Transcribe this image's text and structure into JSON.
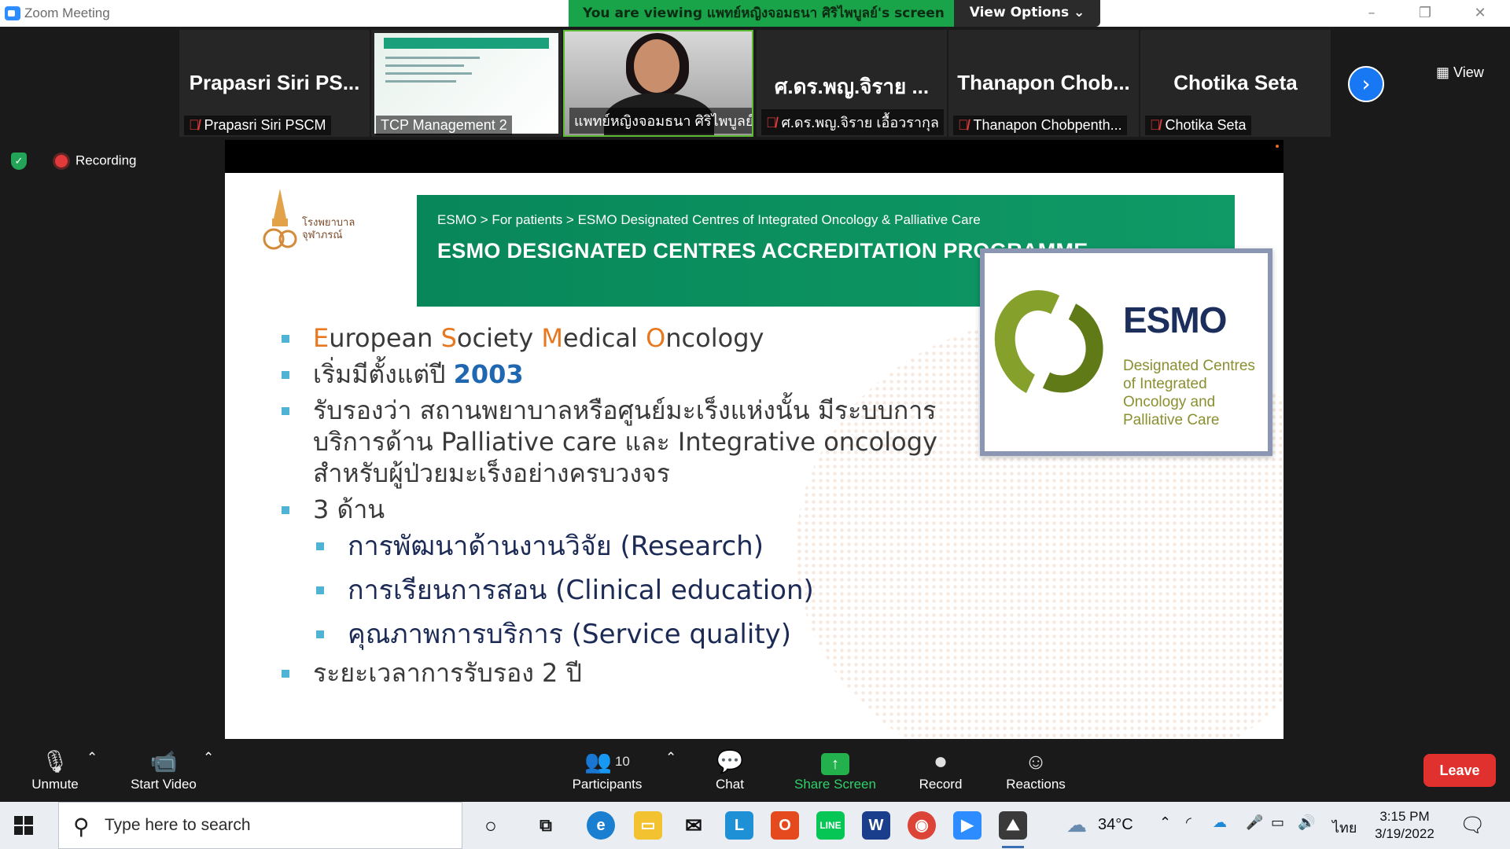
{
  "window": {
    "title": "Zoom Meeting"
  },
  "banner": {
    "text": "You are viewing แพทย์หญิงจอมธนา ศิริไพบูลย์'s screen",
    "view_options": "View Options ⌄"
  },
  "strip": {
    "tiles": [
      {
        "big": "Prapasri  Siri  PS...",
        "label": "Prapasri Siri PSCM",
        "muted": true
      },
      {
        "big": "",
        "label": "TCP Management 2",
        "muted": false
      },
      {
        "big": "",
        "label": "แพทย์หญิงจอมธนา ศิริไพบูลย์",
        "muted": false
      },
      {
        "big": "ศ.ดร.พญ.จิราย ...",
        "label": "ศ.ดร.พญ.จิราย เอื้อวรากุล ...",
        "muted": true
      },
      {
        "big": "Thanapon  Chob...",
        "label": "Thanapon Chobpenth...",
        "muted": true
      },
      {
        "big": "Chotika Seta",
        "label": "Chotika Seta",
        "muted": true
      }
    ],
    "view_label": "View"
  },
  "recording": {
    "label": "Recording"
  },
  "slide": {
    "hospital": {
      "line1": "โรงพยาบาล",
      "line2": "จุฬาภรณ์"
    },
    "header": {
      "breadcrumb": "ESMO  >  For patients  >  ESMO Designated Centres of Integrated Oncology & Palliative Care",
      "title": "ESMO DESIGNATED CENTRES ACCREDITATION PROGRAMME"
    },
    "esmo_logo": {
      "word": "ESMO",
      "subtitle": "Designated Centres of Integrated Oncology and Palliative Care"
    },
    "bullets": {
      "b1": {
        "e": "E",
        "uropean": "uropean ",
        "s": "S",
        "ociety": "ociety ",
        "m": "M",
        "edical": "edical ",
        "o": "O",
        "ncology": "ncology"
      },
      "b2": {
        "text": "เริ่มมีตั้งแต่ปี ",
        "year": "2003"
      },
      "b3": "รับรองว่า สถานพยาบาลหรือศูนย์มะเร็งแห่งนั้น มีระบบการบริการด้าน Palliative care และ Integrative oncology สำหรับผู้ป่วยมะเร็งอย่างครบวงจร",
      "b4": "3 ด้าน",
      "sub1": "การพัฒนาด้านงานวิจัย (Research)",
      "sub2": "การเรียนการสอน (Clinical education)",
      "sub3": "คุณภาพการบริการ (Service quality)",
      "b5": "ระยะเวลาการรับรอง 2 ปี"
    }
  },
  "toolbar": {
    "unmute": "Unmute",
    "start_video": "Start Video",
    "participants": "Participants",
    "participants_count": "10",
    "chat": "Chat",
    "share_screen": "Share Screen",
    "record": "Record",
    "reactions": "Reactions",
    "leave": "Leave"
  },
  "taskbar": {
    "search_placeholder": "Type here to search",
    "temperature": "34°C",
    "language": "ไทย",
    "time": "3:15 PM",
    "date": "3/19/2022"
  }
}
